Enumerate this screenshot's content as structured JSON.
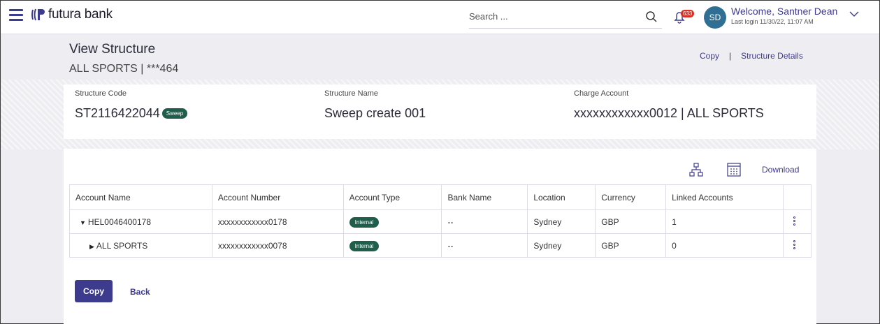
{
  "header": {
    "brand": "futura bank",
    "search_placeholder": "Search ...",
    "notification_count": "633",
    "avatar_initials": "SD",
    "welcome": "Welcome, Santner Dean",
    "last_login": "Last login 11/30/22, 11:07 AM"
  },
  "page": {
    "title": "View Structure",
    "subtitle": "ALL SPORTS | ***464",
    "links": {
      "copy": "Copy",
      "separator": "|",
      "structure_details": "Structure Details"
    }
  },
  "summary": {
    "structure_code_label": "Structure Code",
    "structure_code": "ST2116422044",
    "structure_badge": "Sweep",
    "structure_name_label": "Structure Name",
    "structure_name": "Sweep create 001",
    "charge_account_label": "Charge Account",
    "charge_account": "xxxxxxxxxxxx0012 | ALL SPORTS"
  },
  "toolbar": {
    "download": "Download"
  },
  "table": {
    "headers": [
      "Account Name",
      "Account Number",
      "Account Type",
      "Bank Name",
      "Location",
      "Currency",
      "Linked Accounts"
    ],
    "rows": [
      {
        "name": "HEL0046400178",
        "number": "xxxxxxxxxxxx0178",
        "type": "Internal",
        "bank": "--",
        "location": "Sydney",
        "currency": "GBP",
        "linked": "1"
      },
      {
        "name": "ALL SPORTS",
        "number": "xxxxxxxxxxxx0078",
        "type": "Internal",
        "bank": "--",
        "location": "Sydney",
        "currency": "GBP",
        "linked": "0"
      }
    ]
  },
  "actions": {
    "copy": "Copy",
    "back": "Back"
  },
  "colors": {
    "primary": "#3d3b8e",
    "badge_green": "#1e5e4a",
    "alert_red": "#d93025",
    "avatar": "#2f6f94"
  }
}
